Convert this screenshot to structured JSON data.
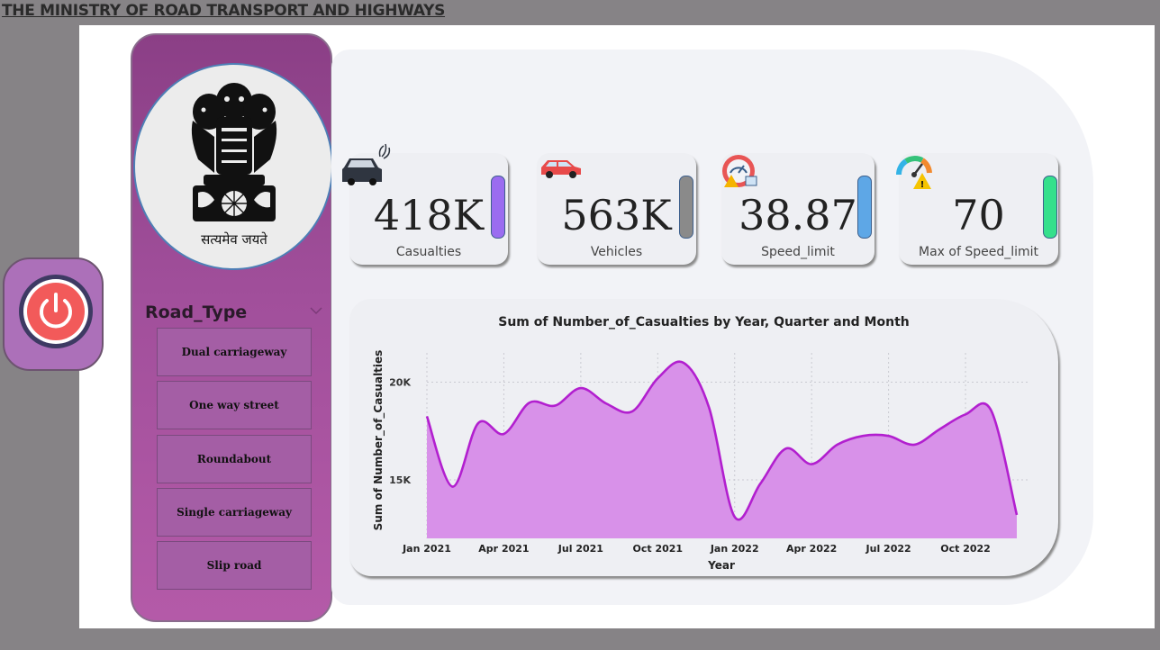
{
  "header": {
    "title": "THE MINISTRY OF ROAD TRANSPORT AND HIGHWAYS"
  },
  "emblem": {
    "motto": "सत्यमेव जयते"
  },
  "power_button": {
    "icon": "power-icon"
  },
  "slicer": {
    "title": "Road_Type",
    "items": [
      {
        "label": "Dual carriageway"
      },
      {
        "label": "One way street"
      },
      {
        "label": "Roundabout"
      },
      {
        "label": "Single carriageway"
      },
      {
        "label": "Slip road"
      }
    ]
  },
  "kpis": [
    {
      "value": "418K",
      "label": "Casualties",
      "icon": "car-crash-icon",
      "accent": "#9b6cf0"
    },
    {
      "value": "563K",
      "label": "Vehicles",
      "icon": "car-icon",
      "accent": "#8a8a8a"
    },
    {
      "value": "38.87",
      "label": "Speed_limit",
      "icon": "speedometer-warning-icon",
      "accent": "#5ea7e6"
    },
    {
      "value": "70",
      "label": "Max of Speed_limit",
      "icon": "gauge-warning-icon",
      "accent": "#35e08c"
    }
  ],
  "chart_data": {
    "type": "area",
    "title": "Sum of Number_of_Casualties by Year, Quarter and Month",
    "xlabel": "Year",
    "ylabel": "Sum of Number_of_Casualties",
    "x": [
      "Jan 2021",
      "Feb 2021",
      "Mar 2021",
      "Apr 2021",
      "May 2021",
      "Jun 2021",
      "Jul 2021",
      "Aug 2021",
      "Sep 2021",
      "Oct 2021",
      "Nov 2021",
      "Dec 2021",
      "Jan 2022",
      "Feb 2022",
      "Mar 2022",
      "Apr 2022",
      "May 2022",
      "Jun 2022",
      "Jul 2022",
      "Aug 2022",
      "Sep 2022",
      "Oct 2022",
      "Nov 2022",
      "Dec 2022"
    ],
    "x_tick_labels": [
      "Jan 2021",
      "Apr 2021",
      "Jul 2021",
      "Oct 2021",
      "Jan 2022",
      "Apr 2022",
      "Jul 2022",
      "Oct 2022"
    ],
    "y_tick_labels": [
      "15K",
      "20K"
    ],
    "y_ticks": [
      15000,
      20000
    ],
    "ylim": [
      12000,
      21500
    ],
    "series": [
      {
        "values": [
          18250,
          14650,
          17900,
          17350,
          18950,
          18800,
          19700,
          18900,
          18500,
          20200,
          21000,
          18700,
          13100,
          14800,
          16600,
          15800,
          16800,
          17250,
          17250,
          16800,
          17600,
          18350,
          18550,
          13200
        ]
      }
    ],
    "grid": true,
    "colors": {
      "line": "#b21fcf",
      "fill": "#d891e9"
    }
  }
}
